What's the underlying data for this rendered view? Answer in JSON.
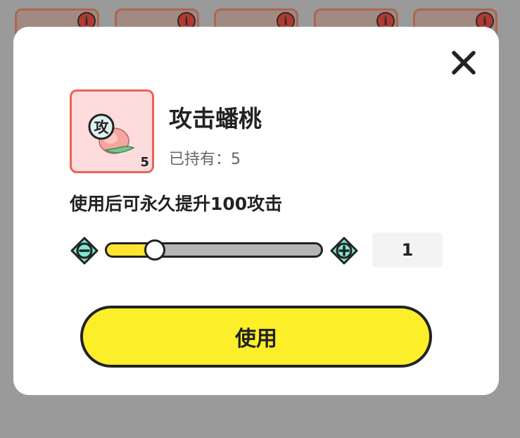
{
  "background_slots": [
    {
      "info_icon": "i"
    },
    {
      "info_icon": "i"
    },
    {
      "info_icon": "i"
    },
    {
      "info_icon": "i"
    },
    {
      "info_icon": "i"
    }
  ],
  "dialog": {
    "close_icon": "close-icon",
    "item": {
      "icon": "peach-icon",
      "icon_badge": "攻",
      "count": "5",
      "name": "攻击蟠桃",
      "owned_text": "已持有：5"
    },
    "description": "使用后可永久提升100攻击",
    "quantity": {
      "value": "1",
      "slider_fraction": 0.23,
      "minus_icon": "minus-icon",
      "plus_icon": "plus-icon"
    },
    "use_button_label": "使用"
  },
  "colors": {
    "accent_yellow": "#fdee2a",
    "item_border": "#ea6455",
    "item_bg": "#fcdcdc",
    "stepper_teal": "#7de8d2",
    "overlay": "#9a9a9a"
  }
}
